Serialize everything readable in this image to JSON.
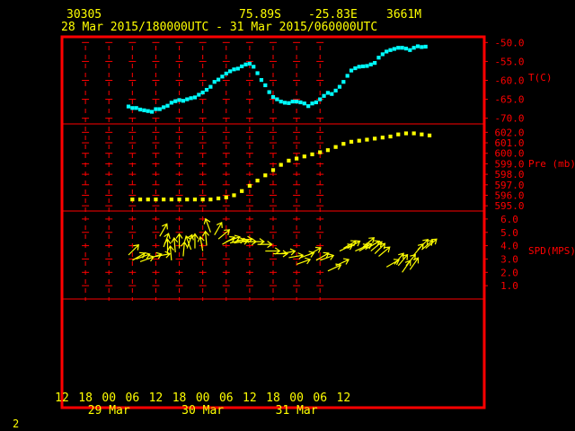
{
  "header": {
    "station": "30305",
    "lat": "75.89S",
    "lon": "-25.83E",
    "elev": "3661M",
    "time_range": "28 Mar 2015/180000UTC - 31 Mar 2015/060000UTC"
  },
  "page_number": "2",
  "colors": {
    "background": "#000000",
    "frame": "#ff0000",
    "grid": "#ff0000",
    "text": "#ffff00",
    "axis_labels": "#ff0000",
    "temperature": "#00ffff",
    "pressure": "#ffff00",
    "wind": "#ffff00"
  },
  "chart_data": [
    {
      "type": "scatter",
      "title": "",
      "ylabel": "T(C)",
      "ylim": [
        -71.5,
        -48.5
      ],
      "yticks": [
        -50,
        -55,
        -60,
        -65,
        -70
      ],
      "ytick_labels": [
        "-50.0",
        "-55.0",
        "-60.0",
        "-65.0",
        "-70.0"
      ],
      "series": [
        {
          "x": [
            17,
            18,
            19,
            20,
            21,
            22,
            23,
            24,
            25,
            26,
            27,
            28,
            29,
            30,
            31,
            32,
            33,
            34,
            35,
            36,
            37,
            38,
            39,
            40,
            41,
            42,
            43,
            44,
            45,
            46,
            47,
            48,
            49,
            50,
            51,
            52,
            53,
            54,
            55,
            56,
            57,
            58,
            59,
            60,
            61,
            62,
            63,
            64,
            65,
            66,
            67,
            68,
            69,
            70,
            71,
            72,
            73,
            74,
            75,
            76,
            77,
            78,
            79,
            80,
            81,
            82,
            83,
            84,
            85,
            86,
            87,
            88,
            89,
            90,
            91,
            92,
            93
          ],
          "y": [
            -66.9,
            -67.3,
            -67.3,
            -67.7,
            -67.9,
            -68.1,
            -68.3,
            -67.6,
            -67.6,
            -67.1,
            -66.7,
            -65.9,
            -65.5,
            -65.2,
            -65.4,
            -65.0,
            -64.7,
            -64.5,
            -63.8,
            -63.2,
            -62.5,
            -61.7,
            -60.4,
            -59.8,
            -59.0,
            -58.2,
            -57.6,
            -57.1,
            -56.9,
            -56.3,
            -55.8,
            -55.6,
            -56.4,
            -58.1,
            -59.9,
            -61.3,
            -63.1,
            -64.4,
            -65.0,
            -65.6,
            -65.9,
            -66.0,
            -65.6,
            -65.6,
            -65.8,
            -66.1,
            -66.8,
            -66.1,
            -65.8,
            -65.0,
            -64.1,
            -63.3,
            -63.6,
            -62.7,
            -61.7,
            -60.4,
            -58.8,
            -57.4,
            -56.8,
            -56.4,
            -56.3,
            -56.2,
            -55.8,
            -55.4,
            -54.0,
            -53.1,
            -52.4,
            -52.0,
            -51.7,
            -51.4,
            -51.4,
            -51.6,
            -52.0,
            -51.4,
            -51.0,
            -51.2,
            -51.1
          ]
        }
      ]
    },
    {
      "type": "scatter",
      "title": "",
      "ylabel": "Pre (mb)",
      "ylim": [
        594.5,
        602.8
      ],
      "yticks": [
        602,
        601,
        600,
        599,
        598,
        597,
        596,
        595
      ],
      "ytick_labels": [
        "602.0",
        "601.0",
        "600.0",
        "599.0",
        "598.0",
        "597.0",
        "596.0",
        "595.0"
      ],
      "series": [
        {
          "x": [
            18,
            20,
            22,
            24,
            26,
            28,
            30,
            32,
            34,
            36,
            38,
            40,
            42,
            44,
            46,
            48,
            50,
            52,
            54,
            56,
            58,
            60,
            62,
            64,
            66,
            68,
            70,
            72,
            74,
            76,
            78,
            80,
            82,
            84,
            86,
            88,
            90,
            92,
            94
          ],
          "y": [
            595.6,
            595.6,
            595.6,
            595.6,
            595.6,
            595.6,
            595.6,
            595.6,
            595.6,
            595.6,
            595.6,
            595.7,
            595.8,
            596.0,
            596.4,
            596.9,
            597.4,
            597.9,
            598.4,
            598.9,
            599.3,
            599.5,
            599.7,
            599.9,
            600.1,
            600.3,
            600.6,
            600.9,
            601.1,
            601.2,
            601.3,
            601.4,
            601.5,
            601.6,
            601.8,
            601.9,
            601.9,
            601.8,
            601.7
          ]
        }
      ]
    },
    {
      "type": "scatter",
      "title": "",
      "ylabel": "SPD(MPS)",
      "ylim": [
        0,
        6.6
      ],
      "yticks": [
        1,
        2,
        3,
        4,
        5,
        6
      ],
      "ytick_labels": [
        "1.0",
        "2.0",
        "3.0",
        "4.0",
        "5.0",
        "6.0"
      ],
      "series": [
        {
          "x": [
            17,
            18,
            19,
            20,
            22,
            24,
            25,
            26,
            27,
            28,
            29,
            30,
            31,
            32,
            33,
            34,
            36,
            37,
            38,
            39,
            40,
            41,
            42,
            43,
            44,
            45,
            46,
            48,
            50,
            52,
            54,
            56,
            58,
            60,
            61,
            63,
            65,
            66,
            68,
            70,
            71,
            72,
            73,
            75,
            76,
            77,
            78,
            79,
            80,
            81,
            83,
            85,
            86,
            87,
            88,
            89,
            90,
            91,
            92,
            93
          ],
          "y": [
            3.3,
            2.9,
            3.0,
            2.8,
            3.0,
            3.2,
            4.7,
            3.9,
            3.4,
            2.9,
            3.5,
            3.8,
            3.2,
            3.8,
            3.7,
            3.8,
            3.6,
            4.0,
            5.0,
            4.8,
            4.5,
            4.1,
            4.3,
            4.2,
            4.2,
            4.4,
            4.3,
            4.3,
            4.1,
            3.6,
            3.4,
            3.4,
            3.1,
            2.6,
            3.1,
            3.3,
            2.9,
            2.9,
            2.1,
            2.5,
            3.6,
            3.8,
            3.8,
            3.6,
            3.6,
            3.9,
            3.8,
            3.6,
            3.4,
            3.2,
            2.4,
            2.6,
            2.5,
            2.0,
            2.5,
            2.2,
            3.3,
            3.7,
            3.7,
            3.8
          ],
          "dir_deg": [
            225,
            240,
            250,
            250,
            250,
            260,
            210,
            200,
            180,
            175,
            175,
            180,
            185,
            200,
            160,
            180,
            170,
            175,
            160,
            210,
            230,
            240,
            250,
            255,
            260,
            265,
            270,
            270,
            270,
            270,
            270,
            260,
            260,
            250,
            250,
            240,
            240,
            250,
            245,
            245,
            245,
            240,
            240,
            245,
            240,
            230,
            240,
            230,
            225,
            230,
            240,
            220,
            220,
            215,
            220,
            215,
            220,
            225,
            230,
            230
          ]
        }
      ]
    }
  ],
  "x_axis": {
    "range_hours": [
      0,
      108
    ],
    "ticks": [
      {
        "h": 0,
        "label": "12"
      },
      {
        "h": 6,
        "label": "18"
      },
      {
        "h": 12,
        "label": "00"
      },
      {
        "h": 18,
        "label": "06"
      },
      {
        "h": 24,
        "label": "12"
      },
      {
        "h": 30,
        "label": "18"
      },
      {
        "h": 36,
        "label": "00"
      },
      {
        "h": 42,
        "label": "06"
      },
      {
        "h": 48,
        "label": "12"
      },
      {
        "h": 54,
        "label": "18"
      },
      {
        "h": 60,
        "label": "00"
      },
      {
        "h": 66,
        "label": "06"
      },
      {
        "h": 72,
        "label": "12"
      }
    ],
    "dates": [
      {
        "h": 12,
        "label": "29 Mar"
      },
      {
        "h": 36,
        "label": "30 Mar"
      },
      {
        "h": 60,
        "label": "31 Mar"
      }
    ]
  }
}
